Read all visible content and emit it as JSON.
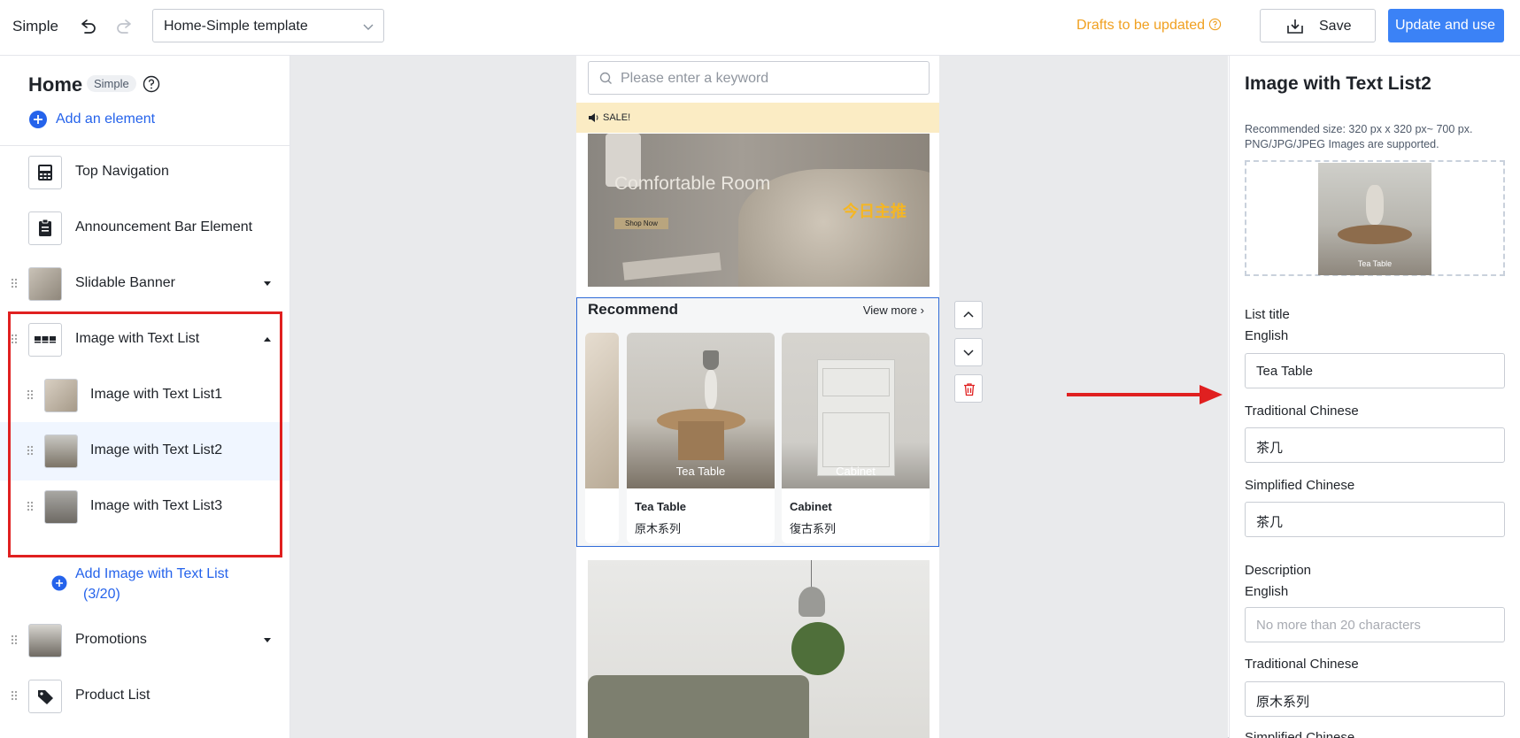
{
  "topbar": {
    "brand": "Simple",
    "template_select": "Home-Simple template",
    "drafts": "Drafts to be updated",
    "save": "Save",
    "update": "Update and use"
  },
  "left": {
    "title": "Home",
    "tag": "Simple",
    "add_element": "Add an element",
    "items": [
      {
        "label": "Top Navigation",
        "icon": "calculator-icon"
      },
      {
        "label": "Announcement Bar Element",
        "icon": "clipboard-icon"
      },
      {
        "label": "Slidable Banner",
        "icon": "banner-thumbnail"
      },
      {
        "label": "Image with Text List",
        "icon": "grid-icon"
      },
      {
        "label": "Image with Text List1",
        "icon": "thumbnail"
      },
      {
        "label": "Image with Text List2",
        "icon": "thumbnail"
      },
      {
        "label": "Image with Text List3",
        "icon": "thumbnail"
      },
      {
        "label": "Promotions",
        "icon": "promo-thumbnail"
      },
      {
        "label": "Product List",
        "icon": "tag-icon"
      }
    ],
    "add_sub_line1": "Add Image with Text List",
    "add_sub_line2": "(3/20)"
  },
  "preview": {
    "search_placeholder": "Please enter a keyword",
    "sale": "SALE!",
    "banner_title": "Comfortable Room",
    "banner_tag": "今日主推",
    "banner_button": "Shop Now",
    "recommend_title": "Recommend",
    "view_more": "View more",
    "cards": [
      {
        "caption": "Tea Table",
        "name": "Tea Table",
        "desc": "原木系列"
      },
      {
        "caption": "Cabinet",
        "name": "Cabinet",
        "desc": "復古系列"
      }
    ]
  },
  "right": {
    "title": "Image with Text List2",
    "note": "Recommended size: 320 px x 320 px~ 700 px. PNG/JPG/JPEG Images are supported.",
    "image_caption": "Tea Table",
    "list_title": "List title",
    "english": "English",
    "traditional_chinese": "Traditional Chinese",
    "simplified_chinese": "Simplified Chinese",
    "title_en": "Tea Table",
    "title_tc": "茶几",
    "title_sc": "茶几",
    "description": "Description",
    "desc_en_placeholder": "No more than 20 characters",
    "desc_tc": "原木系列",
    "simplified_chinese_2": "Simplified Chinese"
  },
  "colors": {
    "accent": "#3b82f6",
    "link": "#2563eb",
    "warning": "#f0a020",
    "highlight": "#e02020",
    "banner_tag": "#f5b623"
  }
}
